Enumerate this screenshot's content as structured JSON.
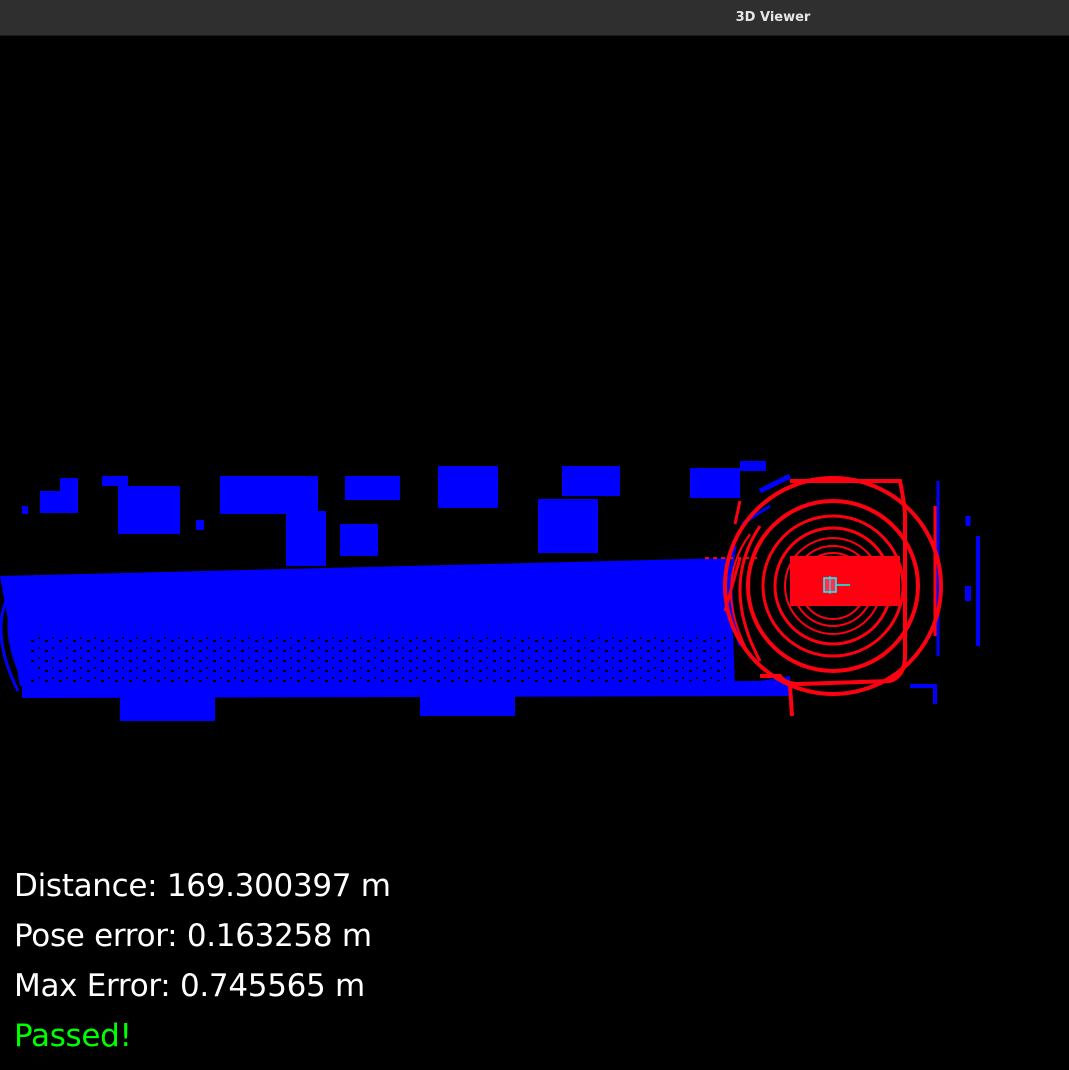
{
  "window": {
    "title": "3D Viewer"
  },
  "hud": {
    "distance": "Distance: 169.300397 m",
    "pose_error": "Pose error: 0.163258 m",
    "max_error": "Max Error: 0.745565 m",
    "status": "Passed!"
  },
  "colors": {
    "map_cloud": "#0000ff",
    "scan_cloud": "#ff0010",
    "vehicle_box": "#00ffff",
    "status_ok": "#00ff00",
    "background": "#000000"
  }
}
